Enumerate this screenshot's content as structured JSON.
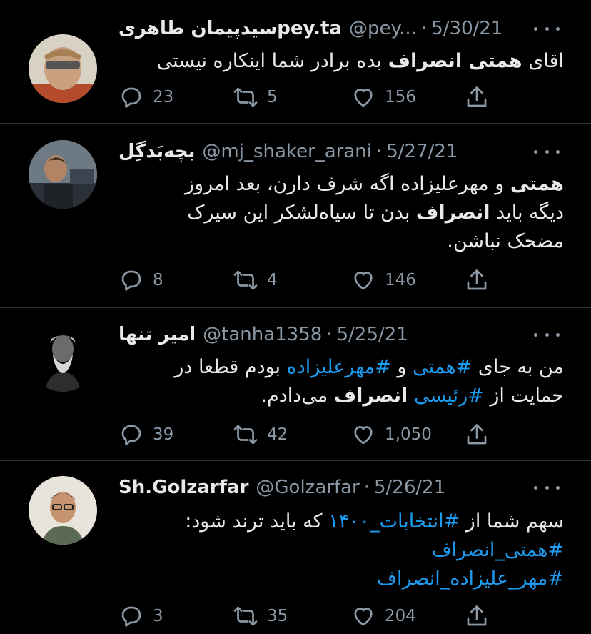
{
  "tweets": [
    {
      "name": "سیدپیمان طاهریpey.ta",
      "handle": "@pey...",
      "date": "5/30/21",
      "lines": [
        [
          {
            "t": "اقای "
          },
          {
            "t": "همتی انصراف",
            "b": true
          },
          {
            "t": " بده برادر شما اینکاره نیستی"
          }
        ]
      ],
      "replies": "23",
      "retweets": "5",
      "likes": "156"
    },
    {
      "name": "بچه‌بَدگِل",
      "handle": "@mj_shaker_arani",
      "date": "5/27/21",
      "lines": [
        [
          {
            "t": "همتی",
            "b": true
          },
          {
            "t": " و مهرعلیزاده اگه شرف دارن، بعد امروز"
          }
        ],
        [
          {
            "t": "دیگه باید "
          },
          {
            "t": "انصراف",
            "b": true
          },
          {
            "t": " بدن تا سیاه‌لشکر این سیرک"
          }
        ],
        [
          {
            "t": "مضحک نباشن."
          }
        ]
      ],
      "replies": "8",
      "retweets": "4",
      "likes": "146"
    },
    {
      "name": "امیر تنها",
      "handle": "@tanha1358",
      "date": "5/25/21",
      "lines": [
        [
          {
            "t": "من به جای "
          },
          {
            "t": "#همتی",
            "h": true
          },
          {
            "t": " و "
          },
          {
            "t": "#مهرعلیزاده",
            "h": true
          },
          {
            "t": " بودم قطعا در"
          }
        ],
        [
          {
            "t": "حمایت از "
          },
          {
            "t": "#رئیسی",
            "h": true
          },
          {
            "t": " "
          },
          {
            "t": "انصراف",
            "b": true
          },
          {
            "t": " می‌دادم."
          }
        ]
      ],
      "replies": "39",
      "retweets": "42",
      "likes": "1,050"
    },
    {
      "name": "Sh.Golzarfar",
      "handle": "@Golzarfar",
      "date": "5/26/21",
      "lines": [
        [
          {
            "t": "سهم شما از "
          },
          {
            "t": "#انتخابات_۱۴۰۰",
            "h": true
          },
          {
            "t": " که باید ترند شود:"
          }
        ],
        [
          {
            "t": "#همتی_انصراف",
            "h": true
          }
        ],
        [
          {
            "t": "#مهر_علیزاده_انصراف",
            "h": true
          }
        ]
      ],
      "replies": "3",
      "retweets": "35",
      "likes": "204"
    }
  ],
  "colors": {
    "background": "#000000",
    "text": "#e7e9ea",
    "muted": "#8b98a5",
    "link": "#1d9bf0",
    "divider": "#2f3336"
  },
  "icons": {
    "reply": "reply-icon",
    "retweet": "retweet-icon",
    "like": "heart-icon",
    "share": "share-icon",
    "more": "more-icon"
  }
}
